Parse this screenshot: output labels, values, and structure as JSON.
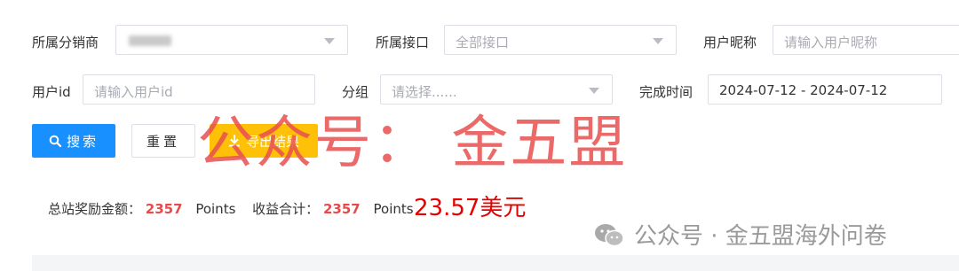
{
  "filters": {
    "distributor": {
      "label": "所属分销商",
      "value": ""
    },
    "interface": {
      "label": "所属接口",
      "value": "全部接口"
    },
    "nickname": {
      "label": "用户昵称",
      "placeholder": "请输入用户昵称"
    },
    "user_id": {
      "label": "用户id",
      "placeholder": "请输入用户id"
    },
    "group": {
      "label": "分组",
      "placeholder": "请选择......"
    },
    "completion_time": {
      "label": "完成时间",
      "value": "2024-07-12 - 2024-07-12"
    }
  },
  "buttons": {
    "search": "搜索",
    "reset": "重置",
    "export": "导出结果"
  },
  "summary": {
    "total_reward_label": "总站奖励金额：",
    "total_reward_value": "2357",
    "total_reward_unit": "Points",
    "income_label": "收益合计：",
    "income_value": "2357",
    "income_unit": "Points",
    "usd_note": "23.57美元"
  },
  "watermark": {
    "text": "公众号： 金五盟",
    "footer": "公众号 · 金五盟海外问卷"
  },
  "colors": {
    "primary": "#1890ff",
    "export": "#ffc107",
    "red": "#e64a4a",
    "border": "#dcdfe6"
  }
}
